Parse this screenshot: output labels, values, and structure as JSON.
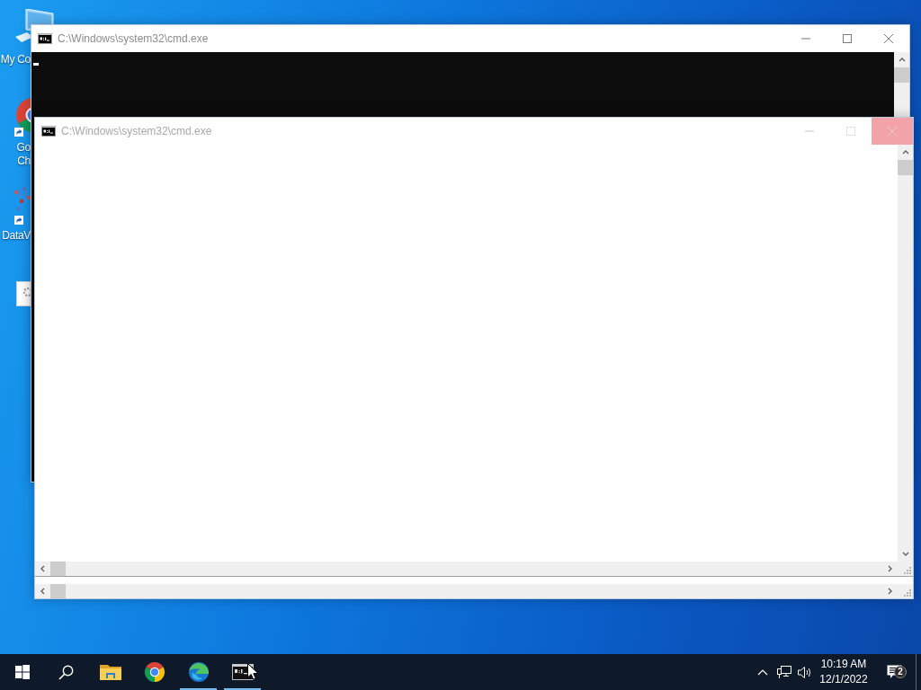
{
  "desktop_icons": [
    {
      "kind": "computer",
      "label_lines": [
        "My Co"
      ]
    },
    {
      "kind": "chrome",
      "label_lines": [
        "Go",
        "Ch"
      ],
      "shortcut": true
    },
    {
      "kind": "network-app",
      "label_lines": [
        "DataV"
      ],
      "shortcut": true
    },
    {
      "kind": "document"
    }
  ],
  "windows": [
    {
      "title": "C:\\Windows\\system32\\cmd.exe",
      "active": false,
      "kind": "console",
      "close_hovered": false
    },
    {
      "title": "C:\\Windows\\system32\\cmd.exe",
      "active": false,
      "kind": "blank",
      "close_hovered": true
    }
  ],
  "taskbar": {
    "apps": [
      {
        "kind": "files",
        "running": false
      },
      {
        "kind": "chrome",
        "running": false
      },
      {
        "kind": "edge",
        "running": true
      },
      {
        "kind": "console",
        "running": true
      }
    ],
    "clock": {
      "time": "10:19 AM",
      "date": "12/1/2022"
    },
    "notification_count": "2"
  }
}
